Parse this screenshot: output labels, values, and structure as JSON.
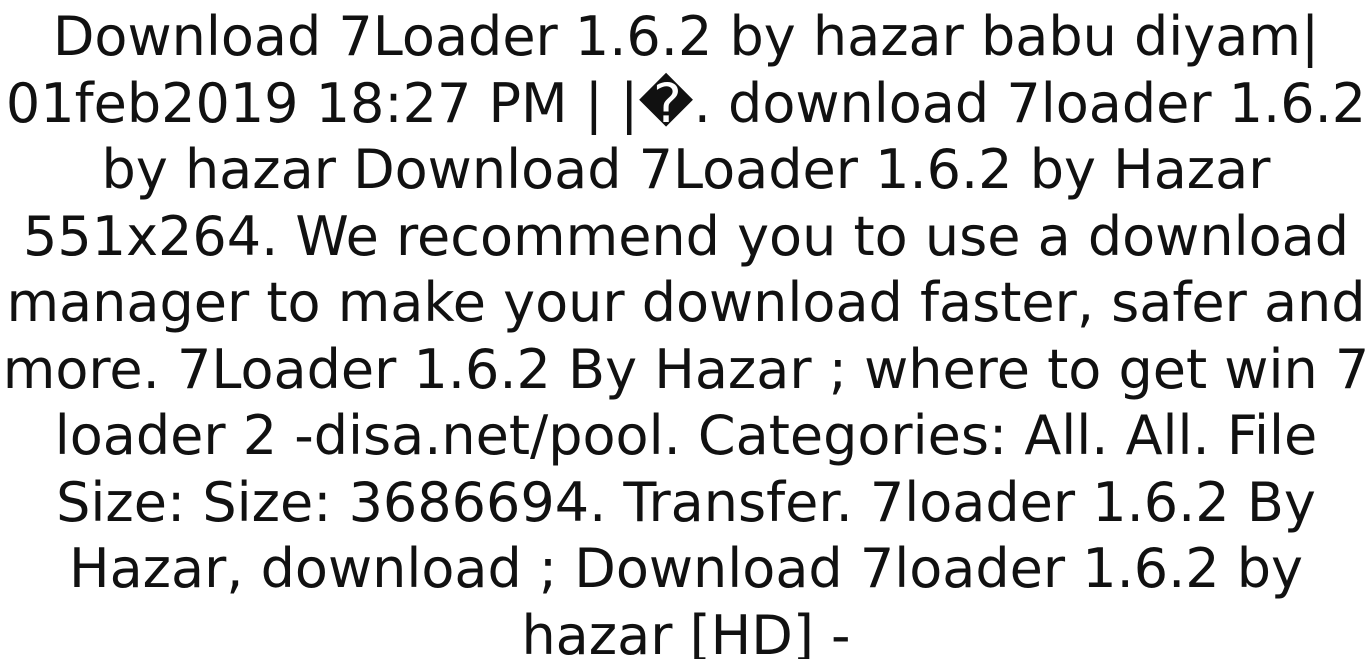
{
  "document": {
    "lines": [
      "Download 7Loader 1.6.2 by hazar babu diyam|",
      "01feb2019 18:27 PM | |�. download 7loader 1.6.2",
      "by hazar Download 7Loader 1.6.2 by Hazar",
      "551x264. We recommend you to use a download",
      "manager to make your download faster, safer and",
      "more. 7Loader 1.6.2 By Hazar ; where to get win 7",
      "loader 2 -disa.net/pool. Categories: All. All. File",
      "Size: Size: 3686694. Transfer. 7loader 1.6.2 By",
      "Hazar, download ; Download 7loader 1.6.2 by",
      "hazar [HD] -"
    ]
  }
}
